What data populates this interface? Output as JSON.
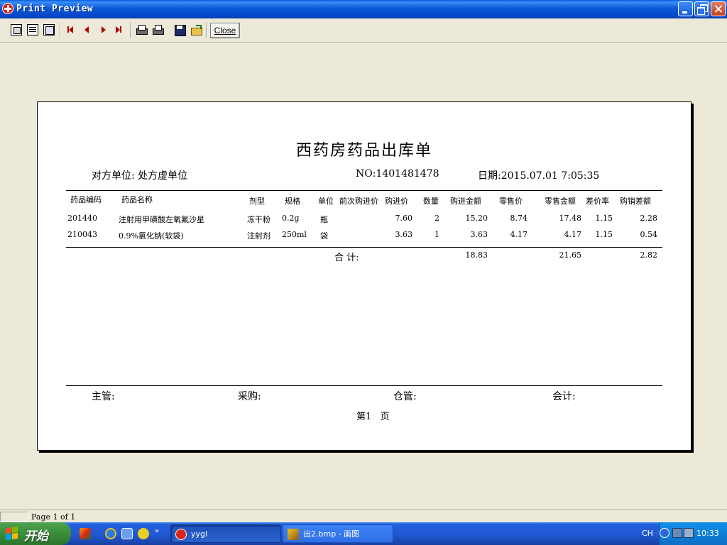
{
  "window": {
    "title": "Print Preview"
  },
  "toolbar": {
    "close_label": "Close"
  },
  "report": {
    "title": "西药房药品出库单",
    "party": "对方单位: 处方虚单位",
    "number": "NO:1401481478",
    "date": "日期:2015.07.01 7:05:35",
    "columns": [
      "药品编码",
      "药品名称",
      "剂型",
      "规格",
      "单位",
      "前次购进价",
      "购进价",
      "数量",
      "购进金额",
      "零售价",
      "零售金额",
      "差价率",
      "购销差额"
    ],
    "rows": [
      [
        "201440",
        "注射用甲磺酸左氧氟沙星",
        "冻干粉",
        "0.2g",
        "瓶",
        "",
        "7.60",
        "2",
        "15.20",
        "8.74",
        "17.48",
        "1.15",
        "2.28"
      ],
      [
        "210043",
        "0.9%氯化钠(软袋)",
        "注射剂",
        "250ml",
        "袋",
        "",
        "3.63",
        "1",
        "3.63",
        "4.17",
        "4.17",
        "1.15",
        "0.54"
      ]
    ],
    "total_label": "合  计:",
    "totals": {
      "purchase_amount": "18.83",
      "retail_amount": "21.65",
      "diff_amount": "2.82"
    },
    "signatures": {
      "supervisor": "主管:",
      "purchaser": "采购:",
      "warehouse": "仓管:",
      "accountant": "会计:"
    },
    "page_label": "第1   页"
  },
  "statusbar": {
    "page_info": "Page 1 of 1"
  },
  "taskbar": {
    "start_label": "开始",
    "tasks": [
      {
        "label": "yygl"
      },
      {
        "label": "出2.bmp - 画图"
      }
    ],
    "language": "CH",
    "clock": "10:33"
  }
}
